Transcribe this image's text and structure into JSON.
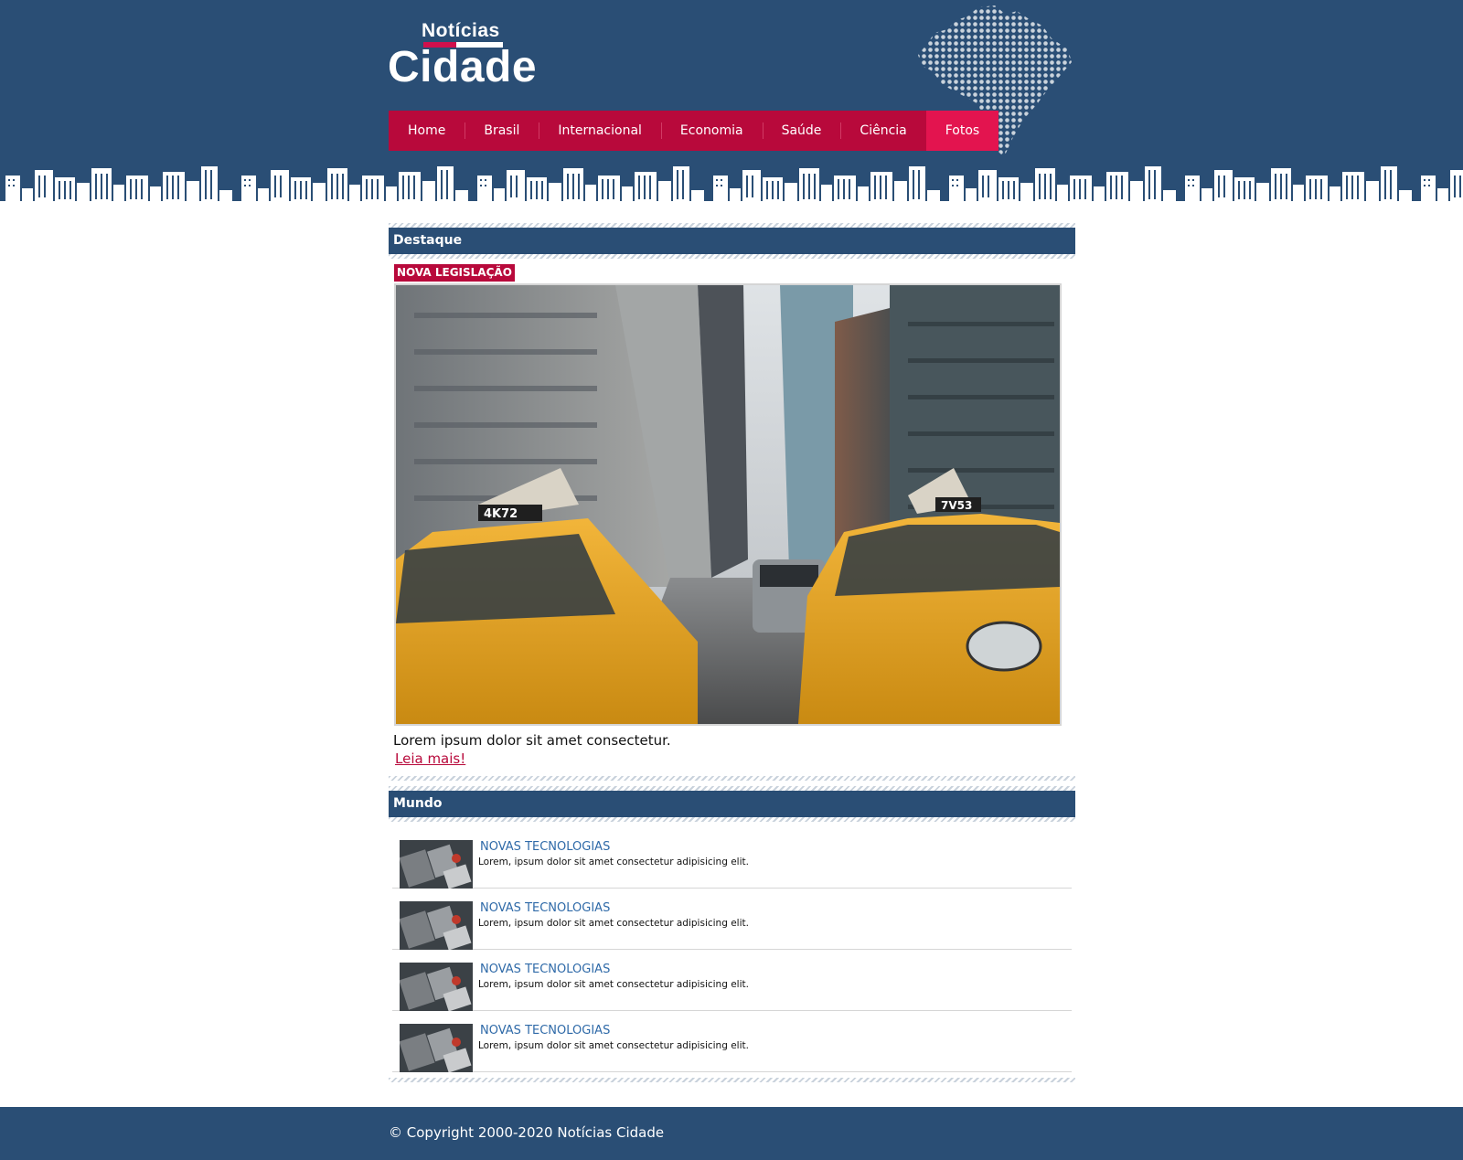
{
  "logo": {
    "top": "Notícias",
    "bottom": "Cidade"
  },
  "nav": {
    "items": [
      {
        "label": "Home",
        "active": false
      },
      {
        "label": "Brasil",
        "active": false
      },
      {
        "label": "Internacional",
        "active": false
      },
      {
        "label": "Economia",
        "active": false
      },
      {
        "label": "Saúde",
        "active": false
      },
      {
        "label": "Ciência",
        "active": false
      },
      {
        "label": "Fotos",
        "active": true
      }
    ]
  },
  "featured": {
    "heading": "Destaque",
    "tag": "NOVA LEGISLAÇÃO",
    "photo_alt": "taxi-street-photo",
    "caption": "Lorem ipsum dolor sit amet consectetur.",
    "read_more": "Leia mais!"
  },
  "world": {
    "heading": "Mundo",
    "items": [
      {
        "title": "NOVAS TECNOLOGIAS",
        "text": "Lorem, ipsum dolor sit amet consectetur adipisicing elit."
      },
      {
        "title": "NOVAS TECNOLOGIAS",
        "text": "Lorem, ipsum dolor sit amet consectetur adipisicing elit."
      },
      {
        "title": "NOVAS TECNOLOGIAS",
        "text": "Lorem, ipsum dolor sit amet consectetur adipisicing elit."
      },
      {
        "title": "NOVAS TECNOLOGIAS",
        "text": "Lorem, ipsum dolor sit amet consectetur adipisicing elit."
      }
    ]
  },
  "footer": {
    "copyright": "© Copyright 2000-2020 Notícias Cidade"
  },
  "colors": {
    "header_blue": "#2a4e75",
    "nav_red": "#b8093b",
    "nav_active": "#e3144f",
    "link_blue": "#2f6aa8"
  }
}
